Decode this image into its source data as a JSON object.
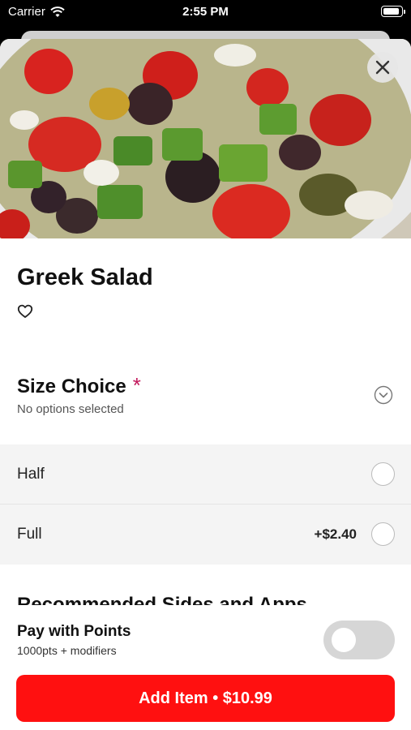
{
  "status_bar": {
    "carrier": "Carrier",
    "time": "2:55 PM"
  },
  "item": {
    "title": "Greek Salad",
    "image_alt_icon": "salad-photo"
  },
  "section": {
    "title": "Size Choice",
    "required_marker": "*",
    "subtitle": "No options selected",
    "options": [
      {
        "label": "Half",
        "price": ""
      },
      {
        "label": "Full",
        "price": "+$2.40"
      }
    ]
  },
  "next_section": {
    "title": "Recommended Sides and Apps"
  },
  "payment": {
    "title": "Pay with Points",
    "subtitle": "1000pts + modifiers",
    "toggle_on": false
  },
  "cta": {
    "label": "Add Item • $10.99"
  },
  "colors": {
    "accent": "#ff1010",
    "required": "#c2185b"
  }
}
